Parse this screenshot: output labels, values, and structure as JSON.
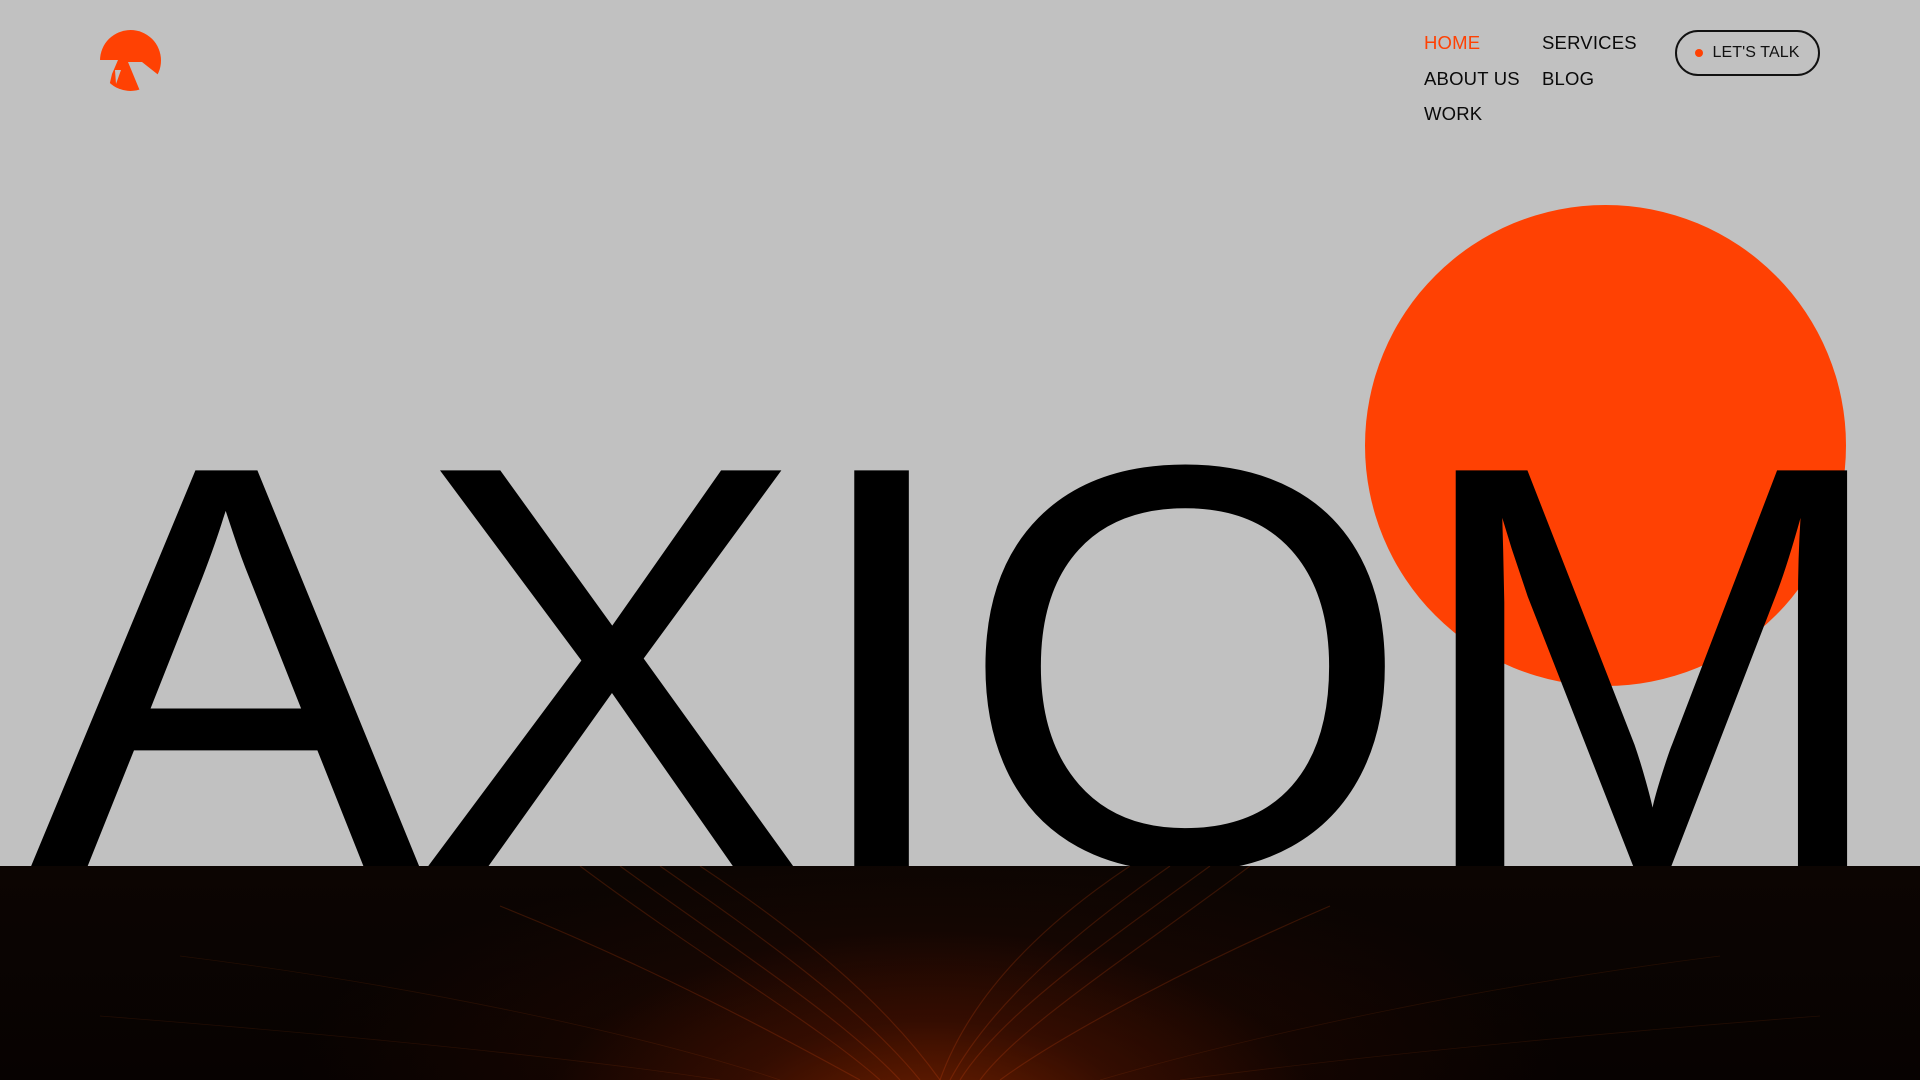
{
  "brand": {
    "logo_icon": "axiom-logo-icon",
    "accent_color": "#ff4103"
  },
  "nav": {
    "items": [
      {
        "label": "HOME",
        "active": true
      },
      {
        "label": "SERVICES",
        "active": false
      },
      {
        "label": "ABOUT US",
        "active": false
      },
      {
        "label": "BLOG",
        "active": false
      },
      {
        "label": "WORK",
        "active": false
      }
    ]
  },
  "cta": {
    "label": "LET'S TALK",
    "icon": "dot-icon"
  },
  "hero": {
    "title": "AXIOM",
    "background_color": "#c1c1c1",
    "circle_color": "#ff4103",
    "band_color": "#0a0302"
  }
}
